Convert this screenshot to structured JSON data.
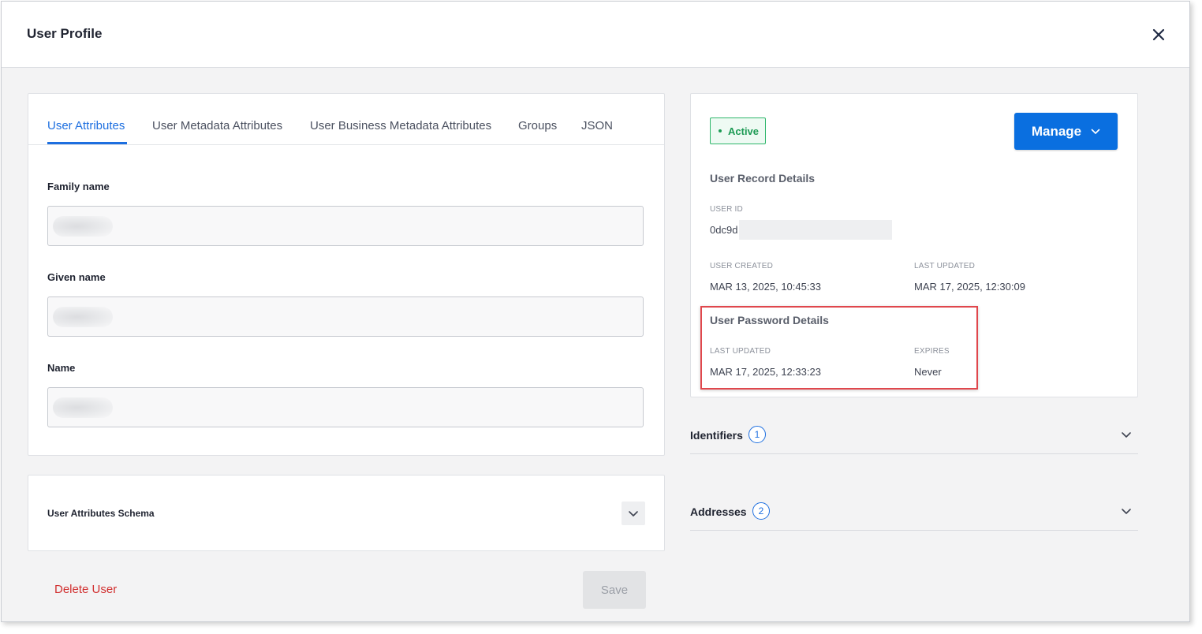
{
  "header": {
    "title": "User Profile"
  },
  "tabs": [
    {
      "label": "User Attributes",
      "active": true
    },
    {
      "label": "User Metadata Attributes",
      "active": false
    },
    {
      "label": "User Business Metadata Attributes",
      "active": false
    },
    {
      "label": "Groups",
      "active": false
    },
    {
      "label": "JSON",
      "active": false
    }
  ],
  "attributes": {
    "family_name_label": "Family name",
    "given_name_label": "Given name",
    "name_label": "Name"
  },
  "schema": {
    "title": "User Attributes Schema"
  },
  "footer": {
    "delete_label": "Delete User",
    "save_label": "Save"
  },
  "status": {
    "label": "Active",
    "color": "#1e9b55"
  },
  "manage": {
    "label": "Manage"
  },
  "record": {
    "title": "User Record Details",
    "user_id_label": "USER ID",
    "user_id_value": "0dc9d",
    "created_label": "USER CREATED",
    "created_value": "MAR 13, 2025, 10:45:33",
    "updated_label": "LAST UPDATED",
    "updated_value": "MAR 17, 2025, 12:30:09"
  },
  "password": {
    "title": "User Password Details",
    "updated_label": "LAST UPDATED",
    "updated_value": "MAR 17, 2025, 12:33:23",
    "expires_label": "EXPIRES",
    "expires_value": "Never"
  },
  "identifiers": {
    "title": "Identifiers",
    "count": "1"
  },
  "addresses": {
    "title": "Addresses",
    "count": "2"
  },
  "colors": {
    "accent": "#1d6fe0",
    "primary_button": "#0a6fe0",
    "danger": "#d12f2f",
    "highlight": "#e0474c"
  }
}
